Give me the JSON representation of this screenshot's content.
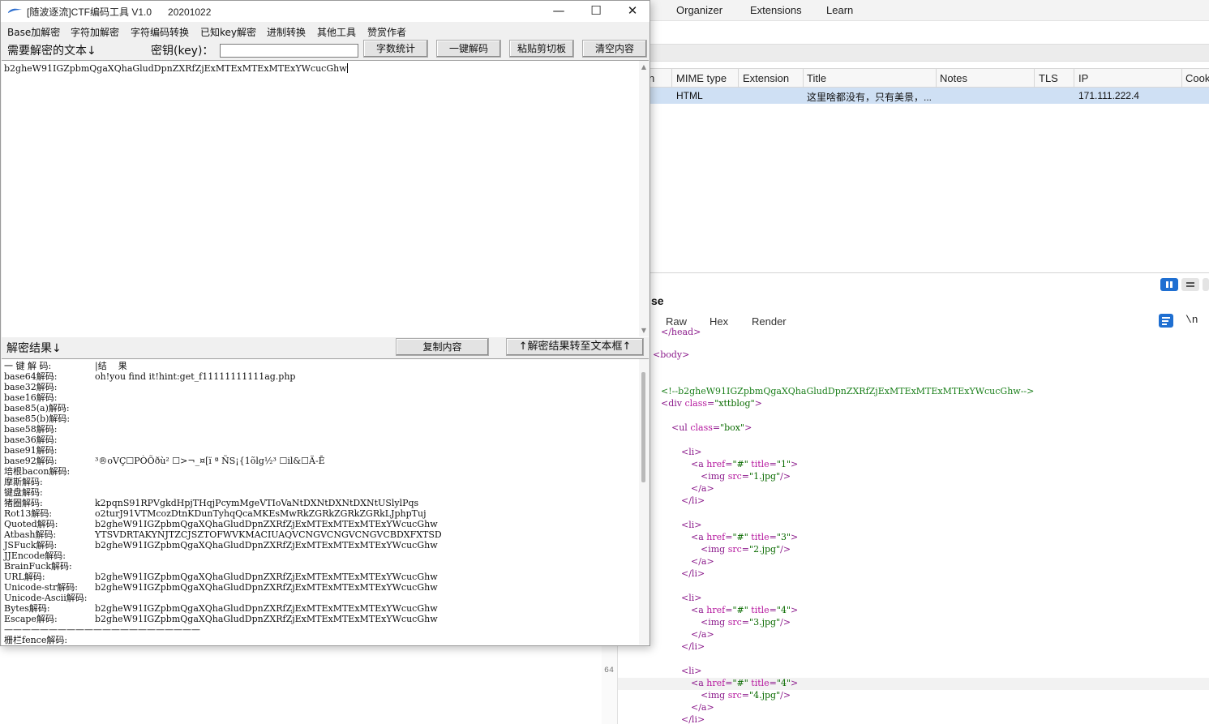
{
  "background_app": {
    "menu": [
      "Organizer",
      "Extensions",
      "Learn"
    ],
    "table": {
      "columns": [
        "n",
        "MIME type",
        "Extension",
        "Title",
        "Notes",
        "TLS",
        "IP",
        "Cook"
      ],
      "selected_row": {
        "mime": "HTML",
        "title": "这里啥都没有，只有美景，...",
        "ip": "171.111.222.4"
      }
    },
    "section_title": "se",
    "tabs": [
      "Raw",
      "Hex",
      "Render"
    ],
    "newline_toggle": "\\n",
    "line_number": "64",
    "code_lines": [
      {
        "kind": "tag",
        "text": "</head>"
      },
      {
        "kind": "tag",
        "text": "<body>"
      },
      {
        "kind": "comment",
        "text": "<!--b2gheW91IGZpbmQgaXQhaGludDpnZXRfZjExMTExMTExMTExYWcucGhw-->"
      },
      {
        "kind": "div",
        "tag": "div",
        "attr": "class",
        "val": "\"xttblog\""
      },
      {
        "kind": "ul",
        "tag": "ul",
        "attr": "class",
        "val": "\"box\""
      },
      {
        "kind": "tag",
        "text": "<li>"
      },
      {
        "kind": "a",
        "title": "\"1\""
      },
      {
        "kind": "img",
        "src": "\"1.jpg\""
      },
      {
        "kind": "tag",
        "text": "</a>"
      },
      {
        "kind": "tag",
        "text": "</li>"
      },
      {
        "kind": "tag",
        "text": "<li>"
      },
      {
        "kind": "a",
        "title": "\"3\""
      },
      {
        "kind": "img",
        "src": "\"2.jpg\""
      },
      {
        "kind": "tag",
        "text": "</a>"
      },
      {
        "kind": "tag",
        "text": "</li>"
      },
      {
        "kind": "tag",
        "text": "<li>"
      },
      {
        "kind": "a",
        "title": "\"4\""
      },
      {
        "kind": "img",
        "src": "\"3.jpg\""
      },
      {
        "kind": "tag",
        "text": "</a>"
      },
      {
        "kind": "tag",
        "text": "</li>"
      },
      {
        "kind": "tag",
        "text": "<li>"
      },
      {
        "kind": "a",
        "title": "\"4\""
      },
      {
        "kind": "img",
        "src": "\"4.jpg\""
      },
      {
        "kind": "tag",
        "text": "</a>"
      },
      {
        "kind": "tag",
        "text": "</li>"
      }
    ],
    "code_tokens": {
      "a_prefix": "<a ",
      "href_attr": "href",
      "href_val": "\"#\"",
      "title_attr": "title",
      "img_prefix": "<img ",
      "src_attr": "src",
      "self_close": "/>",
      "close": ">",
      "eq": "="
    }
  },
  "window": {
    "title": "[随波逐流]CTF编码工具 V1.0      20201022",
    "controls": {
      "minimize": "—",
      "maximize": "☐",
      "close": "✕"
    },
    "menu": [
      "Base加解密",
      "字符加解密",
      "字符编码转换",
      "已知key解密",
      "进制转换",
      "其他工具",
      "赞赏作者"
    ],
    "input_label": "需要解密的文本↓",
    "key_label": "密钥(key)：",
    "key_value": "",
    "buttons": {
      "count": "字数统计",
      "decode_all": "一键解码",
      "paste": "粘贴剪切板",
      "clear": "清空内容",
      "copy": "复制内容",
      "to_input": "↑解密结果转至文本框↑"
    },
    "input_text": "b2gheW91IGZpbmQgaXQhaGludDpnZXRfZjExMTExMTExMTExYWcucGhw",
    "result_label": "解密结果↓",
    "results": [
      {
        "label": "一 键 解 码:",
        "value": "|结    果"
      },
      {
        "label": "base64解码:",
        "value": "oh!you find it!hint:get_f11111111111ag.php"
      },
      {
        "label": "base32解码:",
        "value": ""
      },
      {
        "label": "base16解码:",
        "value": ""
      },
      {
        "label": "base85(a)解码:",
        "value": ""
      },
      {
        "label": "base85(b)解码:",
        "value": ""
      },
      {
        "label": "base58解码:",
        "value": ""
      },
      {
        "label": "base36解码:",
        "value": ""
      },
      {
        "label": "base91解码:",
        "value": ""
      },
      {
        "label": "base92解码:",
        "value": "³®oVÇ☐PÒÕðù² ☐>¬_¤[ï ª ÑS¡{1õlg½³ ☐il&☐Ä-Ē"
      },
      {
        "label": "培根bacon解码:",
        "value": ""
      },
      {
        "label": "摩斯解码:",
        "value": ""
      },
      {
        "label": "键盘解码:",
        "value": ""
      },
      {
        "label": "猪圈解码:",
        "value": "k2pqnS91RPVgkdHpjTHqjPcymMgeVTIoVaNtDXNtDXNtDXNtUSlylPqs"
      },
      {
        "label": "Rot13解码:",
        "value": "o2turJ91VTMcozDtnKDunTyhqQcaMKEsMwRkZGRkZGRkZGRkLJphpTuj"
      },
      {
        "label": "Quoted解码:",
        "value": "b2gheW91IGZpbmQgaXQhaGludDpnZXRfZjExMTExMTExMTExYWcucGhw"
      },
      {
        "label": "Atbash解码:",
        "value": "YTSVDRTAKYNJTZCJSZTOFWVKMACIUAQVCNGVCNGVCNGVCBDXFXTSD"
      },
      {
        "label": "JSFuck解码:",
        "value": "b2gheW91IGZpbmQgaXQhaGludDpnZXRfZjExMTExMTExMTExYWcucGhw"
      },
      {
        "label": "JJEncode解码:",
        "value": ""
      },
      {
        "label": "BrainFuck解码:",
        "value": ""
      },
      {
        "label": "URL解码:",
        "value": "b2gheW91IGZpbmQgaXQhaGludDpnZXRfZjExMTExMTExMTExYWcucGhw"
      },
      {
        "label": "Unicode-str解码:",
        "value": "b2gheW91IGZpbmQgaXQhaGludDpnZXRfZjExMTExMTExMTExYWcucGhw"
      },
      {
        "label": "Unicode-Ascii解码:",
        "value": ""
      },
      {
        "label": "Bytes解码:",
        "value": "b2gheW91IGZpbmQgaXQhaGludDpnZXRfZjExMTExMTExMTExYWcucGhw"
      },
      {
        "label": "Escape解码:",
        "value": "b2gheW91IGZpbmQgaXQhaGludDpnZXRfZjExMTExMTExMTExYWcucGhw"
      },
      {
        "label": "——————————————————————",
        "value": ""
      },
      {
        "label": "栅栏fence解码:",
        "value": ""
      }
    ]
  }
}
